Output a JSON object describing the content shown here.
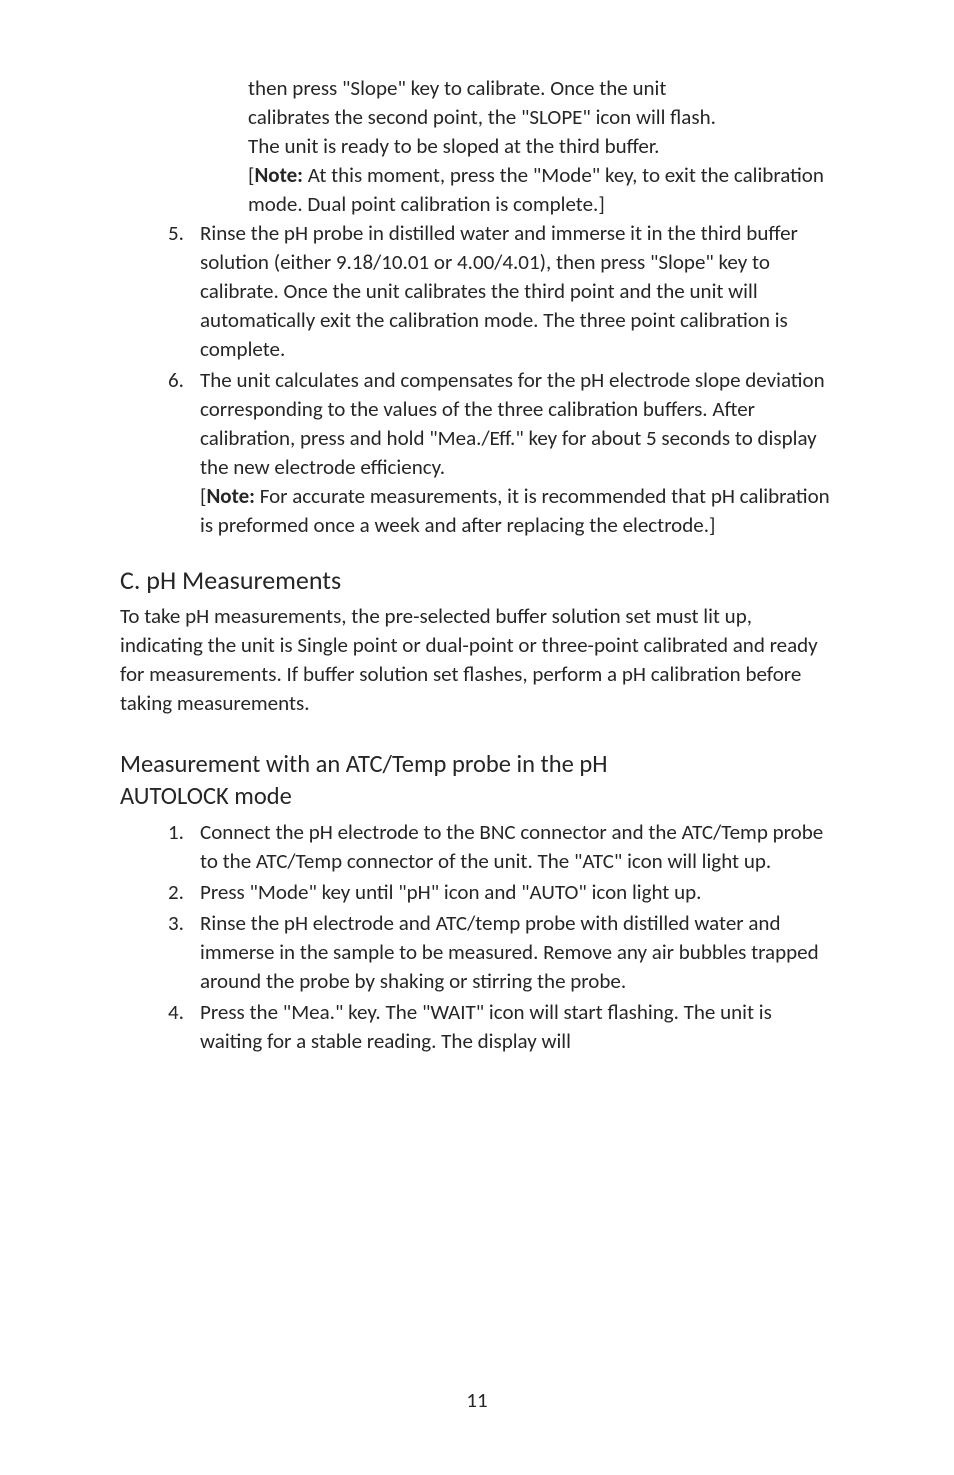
{
  "continuation_block": {
    "lines": [
      "then press \"Slope\" key to calibrate. Once the unit",
      "calibrates the second point, the \"SLOPE\" icon will flash.",
      "The unit is ready to be sloped at the third buffer."
    ],
    "note_label": "Note:",
    "note_text": " At this moment, press the \"Mode\" key, to exit the calibration mode. Dual point calibration is complete.]"
  },
  "list_a": [
    {
      "num": "5.",
      "text": "Rinse the pH probe in distilled water and immerse it in the third buffer solution (either 9.18/10.01 or 4.00/4.01), then press \"Slope\" key to calibrate. Once the unit calibrates the third point and the unit will automatically exit the calibration mode. The three point calibration is complete."
    },
    {
      "num": "6.",
      "text": "The unit calculates and compensates for the pH electrode slope deviation corresponding to the values of the three calibration buffers. After calibration, press and hold \"Mea./Eff.\" key for about 5 seconds to display the new electrode efficiency.",
      "note_label": "Note:",
      "note_text": " For accurate measurements, it is recommended that pH calibration is preformed once a week and after replacing the electrode.]"
    }
  ],
  "section_c": {
    "heading": "C. pH Measurements",
    "paragraph": "To take pH measurements, the pre-selected buffer solution set must lit up, indicating the unit is Single point or dual-point or three-point calibrated and ready for measurements. If buffer solution set flashes, perform a pH calibration before taking measurements."
  },
  "section_measure": {
    "heading_line1": "Measurement with an ATC/Temp probe in the pH",
    "heading_line2": "AUTOLOCK mode",
    "items": [
      {
        "num": "1.",
        "text": "Connect the pH electrode to the BNC connector and the ATC/Temp probe to the ATC/Temp connector of the unit. The \"ATC\" icon will light up."
      },
      {
        "num": "2.",
        "text": "Press \"Mode\" key until \"pH\" icon and \"AUTO\" icon light up."
      },
      {
        "num": "3.",
        "text": "Rinse the pH electrode and ATC/temp probe with distilled water and immerse in the sample to be measured. Remove any air bubbles trapped around the probe by shaking or stirring the probe."
      },
      {
        "num": "4.",
        "text": "Press the \"Mea.\" key. The \"WAIT\" icon will start flashing. The unit is waiting for a stable reading. The display will"
      }
    ]
  },
  "page_number": "11"
}
